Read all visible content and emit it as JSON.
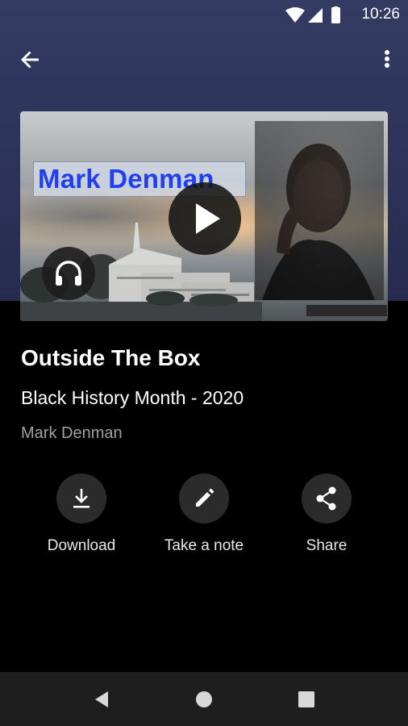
{
  "status_bar": {
    "time": "10:26",
    "icons": [
      "wifi-icon",
      "cellular-signal-icon",
      "battery-icon"
    ]
  },
  "app_bar": {
    "back_icon": "arrow-back-icon",
    "menu_icon": "more-vertical-icon"
  },
  "hero": {
    "overlay_title": "Mark Denman",
    "play_icon": "play-icon",
    "audio_icon": "headphones-icon"
  },
  "sermon": {
    "title": "Outside The Box",
    "series": "Black History Month - 2020",
    "speaker": "Mark Denman"
  },
  "actions": [
    {
      "label": "Download",
      "icon": "download-icon"
    },
    {
      "label": "Take a note",
      "icon": "pencil-icon"
    },
    {
      "label": "Share",
      "icon": "share-icon"
    }
  ],
  "nav_bar": {
    "icons": [
      "back-triangle-icon",
      "home-circle-icon",
      "recents-square-icon"
    ]
  },
  "colors": {
    "header_bg": "#2e3459",
    "background": "#000000",
    "action_circle": "#2b2b2b",
    "nav_bar": "#1e1e1e",
    "hero_title_text": "#1f3ff0",
    "speaker_text": "#a0a0a0"
  }
}
